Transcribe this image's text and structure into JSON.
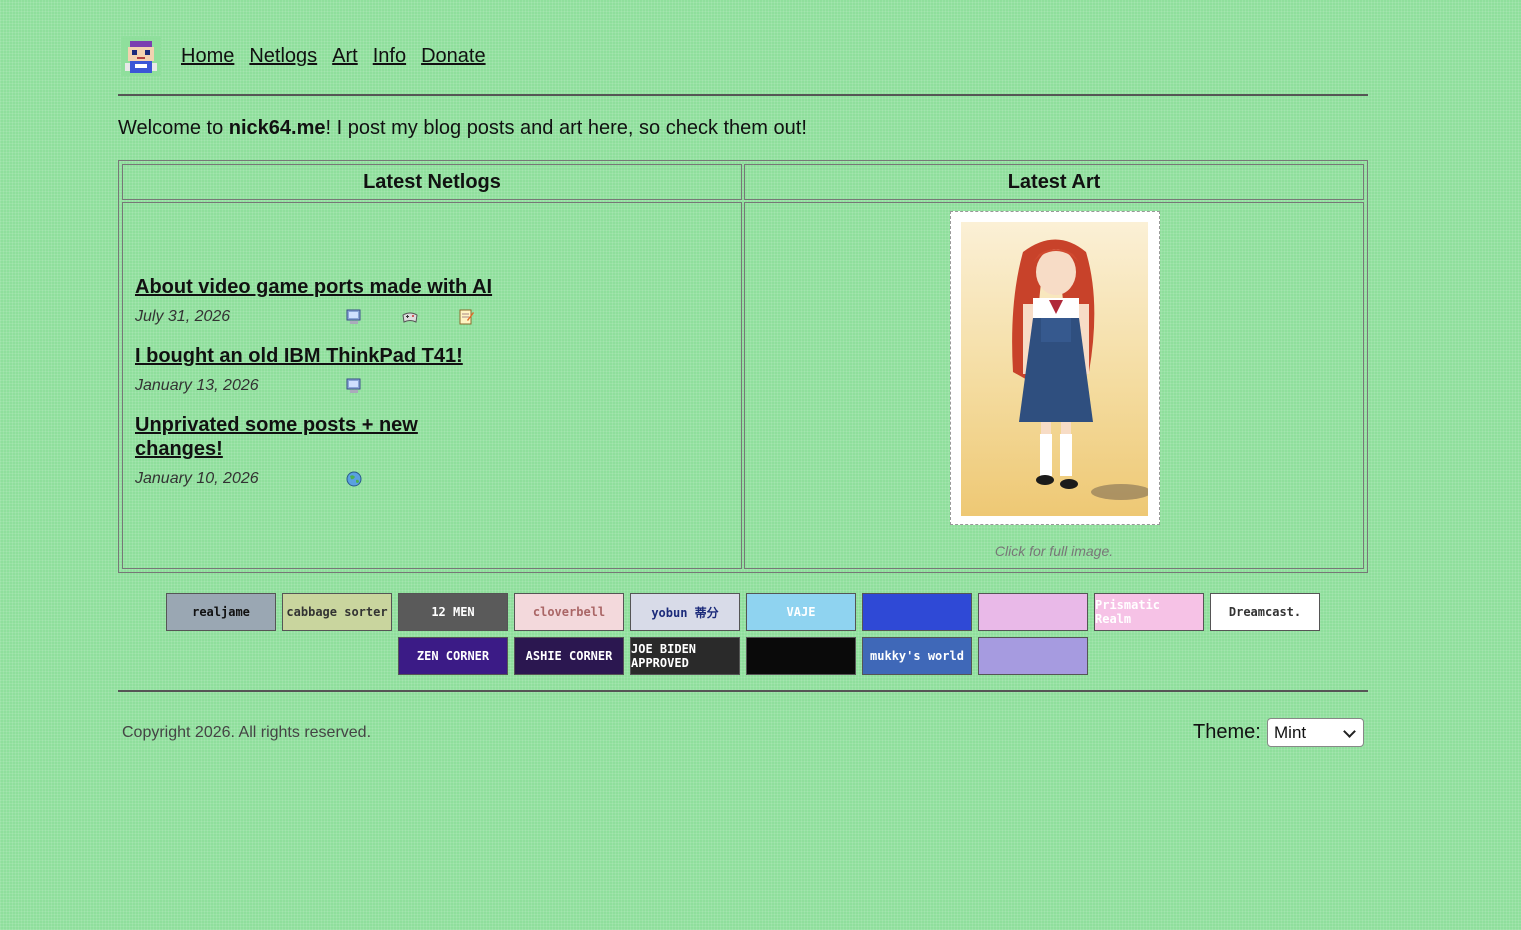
{
  "nav": {
    "logo_icon": "pixel-character-logo-icon",
    "links": [
      "Home",
      "Netlogs",
      "Art",
      "Info",
      "Donate"
    ]
  },
  "welcome": {
    "prefix": "Welcome to ",
    "site": "nick64.me",
    "suffix": "! I post my blog posts and art here, so check them out!"
  },
  "table": {
    "netlogs_header": "Latest Netlogs",
    "art_header": "Latest Art",
    "posts": [
      {
        "title": "About video game ports made with AI",
        "date": "July 31, 2026",
        "tags": [
          "computer-icon",
          "gamepad-icon",
          "notepad-icon"
        ]
      },
      {
        "title": "I bought an old IBM ThinkPad T41!",
        "date": "January 13, 2026",
        "tags": [
          "computer-icon"
        ]
      },
      {
        "title": "Unprivated some posts + new changes!",
        "date": "January 10, 2026",
        "tags": [
          "globe-icon"
        ]
      }
    ],
    "art_caption": "Click for full image."
  },
  "buttons": [
    {
      "label": "realjame",
      "bg": "#9aa7b3"
    },
    {
      "label": "cabbage sorter",
      "bg": "#c9d59e"
    },
    {
      "label": "12 MEN",
      "bg": "#5a5a5a"
    },
    {
      "label": "cloverbell",
      "bg": "#f3d9dc"
    },
    {
      "label": "yobun 蒂分",
      "bg": "#d8dbe8"
    },
    {
      "label": "VAJE",
      "bg": "#8fd3f0"
    },
    {
      "label": "",
      "bg": "#2f49d6"
    },
    {
      "label": "",
      "bg": "#e9b9e8"
    },
    {
      "label": "Prismatic Realm",
      "bg": "#f6c2e6"
    },
    {
      "label": "Dreamcast.",
      "bg": "#ffffff"
    },
    {
      "label": "ZEN CORNER",
      "bg": "#3b1b86"
    },
    {
      "label": "ASHIE CORNER",
      "bg": "#2b1750"
    },
    {
      "label": "JOE BIDEN APPROVED",
      "bg": "#2a2a2a"
    },
    {
      "label": "",
      "bg": "#0a0a0a"
    },
    {
      "label": "mukky's world",
      "bg": "#3f68b8"
    },
    {
      "label": "",
      "bg": "#a69be0"
    }
  ],
  "footer": {
    "copyright": "Copyright 2026. All rights reserved.",
    "theme_label": "Theme:",
    "theme_value": "Mint"
  }
}
